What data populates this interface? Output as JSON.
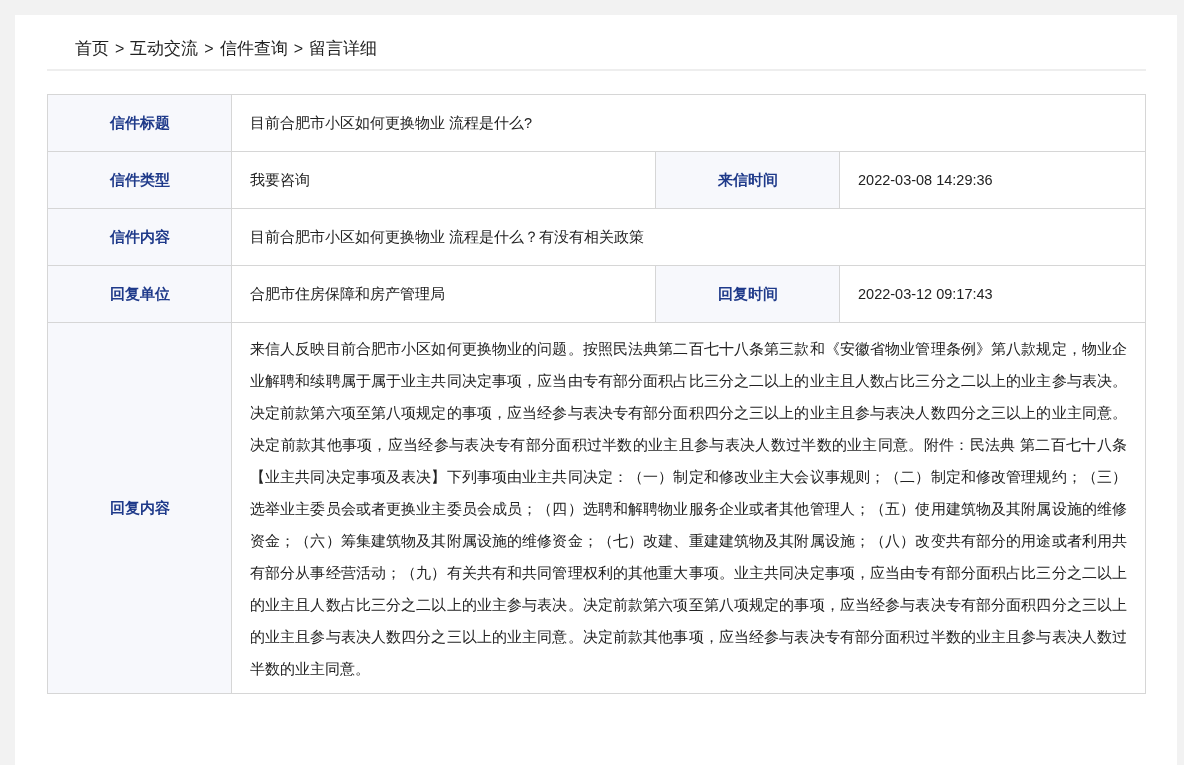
{
  "breadcrumb": {
    "items": [
      "首页",
      "互动交流",
      "信件查询",
      "留言详细"
    ],
    "separator": ">"
  },
  "rows": [
    {
      "kind": "single",
      "label": "信件标题",
      "value": "目前合肥市小区如何更换物业 流程是什么?"
    },
    {
      "kind": "pair",
      "label": "信件类型",
      "value": "我要咨询",
      "label2": "来信时间",
      "value2": "2022-03-08 14:29:36"
    },
    {
      "kind": "single",
      "label": "信件内容",
      "value": "目前合肥市小区如何更换物业 流程是什么？有没有相关政策"
    },
    {
      "kind": "pair",
      "label": "回复单位",
      "value": "合肥市住房保障和房产管理局",
      "label2": "回复时间",
      "value2": "2022-03-12 09:17:43"
    },
    {
      "kind": "long",
      "label": "回复内容",
      "value": "来信人反映目前合肥市小区如何更换物业的问题。按照民法典第二百七十八条第三款和《安徽省物业管理条例》第八款规定，物业企业解聘和续聘属于属于业主共同决定事项，应当由专有部分面积占比三分之二以上的业主且人数占比三分之二以上的业主参与表决。决定前款第六项至第八项规定的事项，应当经参与表决专有部分面积四分之三以上的业主且参与表决人数四分之三以上的业主同意。决定前款其他事项，应当经参与表决专有部分面积过半数的业主且参与表决人数过半数的业主同意。附件：民法典 第二百七十八条【业主共同决定事项及表决】下列事项由业主共同决定：（一）制定和修改业主大会议事规则；（二）制定和修改管理规约；（三）选举业主委员会或者更换业主委员会成员；（四）选聘和解聘物业服务企业或者其他管理人；（五）使用建筑物及其附属设施的维修资金；（六）筹集建筑物及其附属设施的维修资金；（七）改建、重建建筑物及其附属设施；（八）改变共有部分的用途或者利用共有部分从事经营活动；（九）有关共有和共同管理权利的其他重大事项。业主共同决定事项，应当由专有部分面积占比三分之二以上的业主且人数占比三分之二以上的业主参与表决。决定前款第六项至第八项规定的事项，应当经参与表决专有部分面积四分之三以上的业主且参与表决人数四分之三以上的业主同意。决定前款其他事项，应当经参与表决专有部分面积过半数的业主且参与表决人数过半数的业主同意。"
    }
  ]
}
